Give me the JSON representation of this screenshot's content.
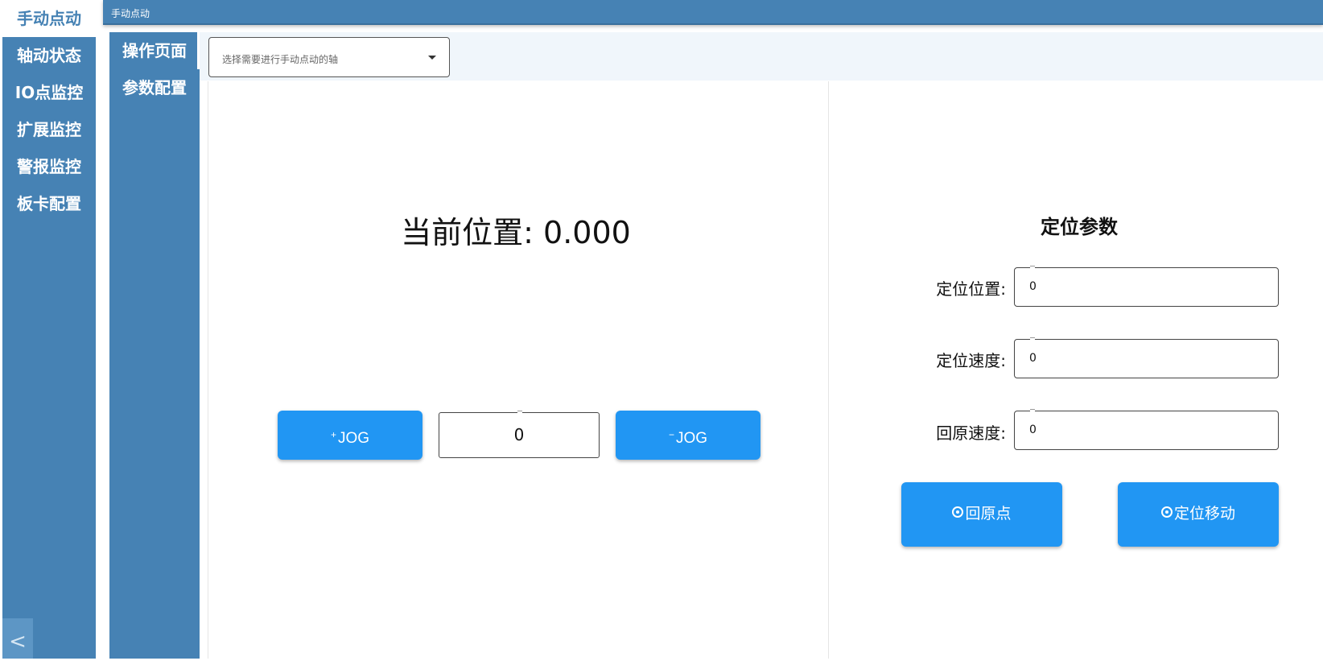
{
  "main_nav": {
    "items": [
      {
        "label": "手动点动"
      },
      {
        "label": "轴动状态"
      },
      {
        "label": "IO点监控"
      },
      {
        "label": "扩展监控"
      },
      {
        "label": "警报监控"
      },
      {
        "label": "板卡配置"
      }
    ],
    "collapse_glyph": "<"
  },
  "title_bar": {
    "title": "手动点动"
  },
  "sub_nav": {
    "items": [
      {
        "label": "操作页面"
      },
      {
        "label": "参数配置"
      }
    ]
  },
  "axis_select": {
    "placeholder": "选择需要进行手动点动的轴"
  },
  "jog": {
    "position_label": "当前位置:",
    "position_value": "0.000",
    "plus_sign": "+",
    "minus_sign": "−",
    "button_text": "JOG",
    "step_value": "0"
  },
  "params": {
    "title": "定位参数",
    "fields": [
      {
        "label": "定位位置:",
        "value": "0"
      },
      {
        "label": "定位速度:",
        "value": "0"
      },
      {
        "label": "回原速度:",
        "value": "0"
      }
    ],
    "home_button": "回原点",
    "move_button": "定位移动"
  },
  "colors": {
    "nav_bg": "#4682b4",
    "button_blue": "#2196f3",
    "strip_bg": "#f0f6fb"
  }
}
